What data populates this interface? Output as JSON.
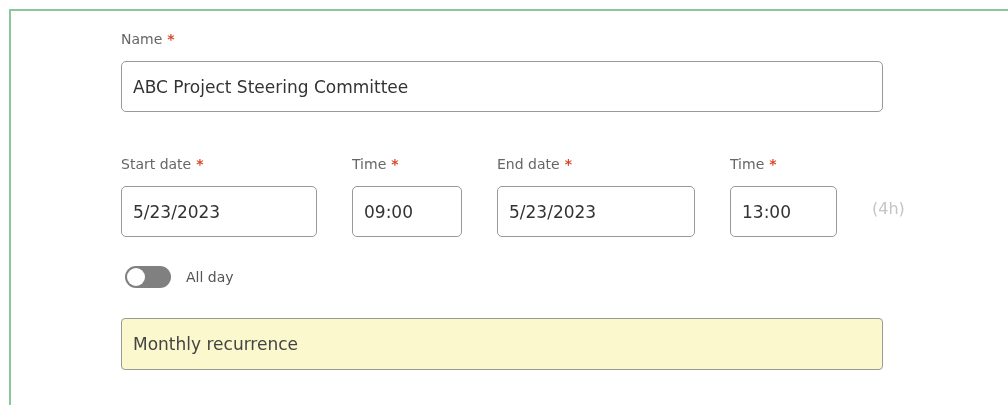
{
  "name_field": {
    "label": "Name",
    "required_mark": "*",
    "value": "ABC Project Steering Committee"
  },
  "date_fields": [
    {
      "kind": "date",
      "label": "Start date",
      "required_mark": "*",
      "value": "5/23/2023"
    },
    {
      "kind": "time",
      "label": "Time",
      "required_mark": "*",
      "value": "09:00"
    },
    {
      "kind": "date",
      "label": "End date",
      "required_mark": "*",
      "value": "5/23/2023"
    },
    {
      "kind": "time",
      "label": "Time",
      "required_mark": "*",
      "value": "13:00"
    }
  ],
  "duration": "(4h)",
  "all_day": {
    "label": "All day",
    "on": false
  },
  "recurrence": "Monthly recurrence"
}
